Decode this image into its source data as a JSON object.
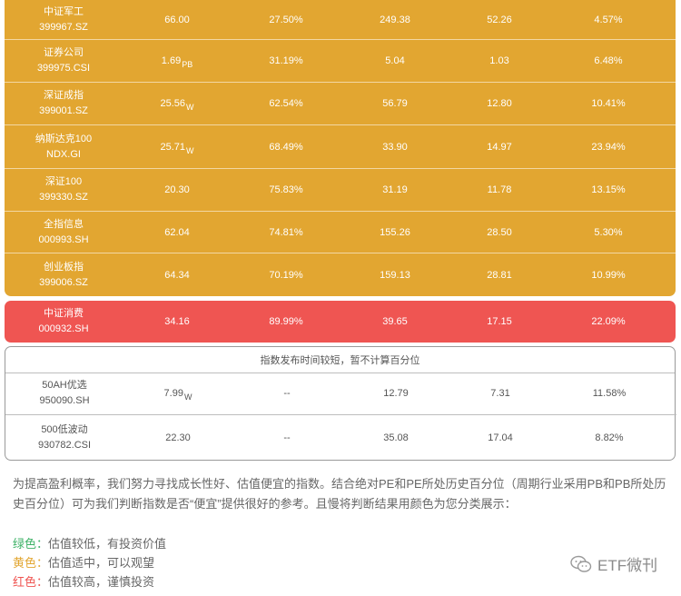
{
  "yellow_rows": [
    {
      "name": "中证军工",
      "code": "399967.SZ",
      "v1": "66.00",
      "v1_sub": "",
      "v2": "27.50%",
      "v3": "249.38",
      "v4": "52.26",
      "v5": "4.57%"
    },
    {
      "name": "证券公司",
      "code": "399975.CSI",
      "v1": "1.69",
      "v1_sub": "PB",
      "v2": "31.19%",
      "v3": "5.04",
      "v4": "1.03",
      "v5": "6.48%"
    },
    {
      "name": "深证成指",
      "code": "399001.SZ",
      "v1": "25.56",
      "v1_sub": "W",
      "v2": "62.54%",
      "v3": "56.79",
      "v4": "12.80",
      "v5": "10.41%"
    },
    {
      "name": "纳斯达克100",
      "code": "NDX.GI",
      "v1": "25.71",
      "v1_sub": "W",
      "v2": "68.49%",
      "v3": "33.90",
      "v4": "14.97",
      "v5": "23.94%"
    },
    {
      "name": "深证100",
      "code": "399330.SZ",
      "v1": "20.30",
      "v1_sub": "",
      "v2": "75.83%",
      "v3": "31.19",
      "v4": "11.78",
      "v5": "13.15%"
    },
    {
      "name": "全指信息",
      "code": "000993.SH",
      "v1": "62.04",
      "v1_sub": "",
      "v2": "74.81%",
      "v3": "155.26",
      "v4": "28.50",
      "v5": "5.30%"
    },
    {
      "name": "创业板指",
      "code": "399006.SZ",
      "v1": "64.34",
      "v1_sub": "",
      "v2": "70.19%",
      "v3": "159.13",
      "v4": "28.81",
      "v5": "10.99%"
    }
  ],
  "red_row": {
    "name": "中证消费",
    "code": "000932.SH",
    "v1": "34.16",
    "v2": "89.99%",
    "v3": "39.65",
    "v4": "17.15",
    "v5": "22.09%"
  },
  "grey_notice": "指数发布时间较短，暂不计算百分位",
  "grey_rows": [
    {
      "name": "50AH优选",
      "code": "950090.SH",
      "v1": "7.99",
      "v1_sub": "W",
      "v2": "--",
      "v3": "12.79",
      "v4": "7.31",
      "v5": "11.58%"
    },
    {
      "name": "500低波动",
      "code": "930782.CSI",
      "v1": "22.30",
      "v1_sub": "",
      "v2": "--",
      "v3": "35.08",
      "v4": "17.04",
      "v5": "8.82%"
    }
  ],
  "paragraph": "为提高盈利概率，我们努力寻找成长性好、估值便宜的指数。结合绝对PE和PE所处历史百分位（周期行业采用PB和PB所处历史百分位）可为我们判断指数是否“便宜”提供很好的参考。且慢将判断结果用颜色为您分类展示：",
  "legend": [
    {
      "color_label": "绿色：",
      "desc": "估值较低，有投资价值",
      "color": "#3eb267"
    },
    {
      "color_label": "黄色：",
      "desc": "估值适中，可以观望",
      "color": "#e2a631"
    },
    {
      "color_label": "红色：",
      "desc": "估值较高，谨慎投资",
      "color": "#ef5552"
    }
  ],
  "watermark": "ETF微刊",
  "colors": {
    "yellow": "#e2a631",
    "red": "#ef5552"
  }
}
